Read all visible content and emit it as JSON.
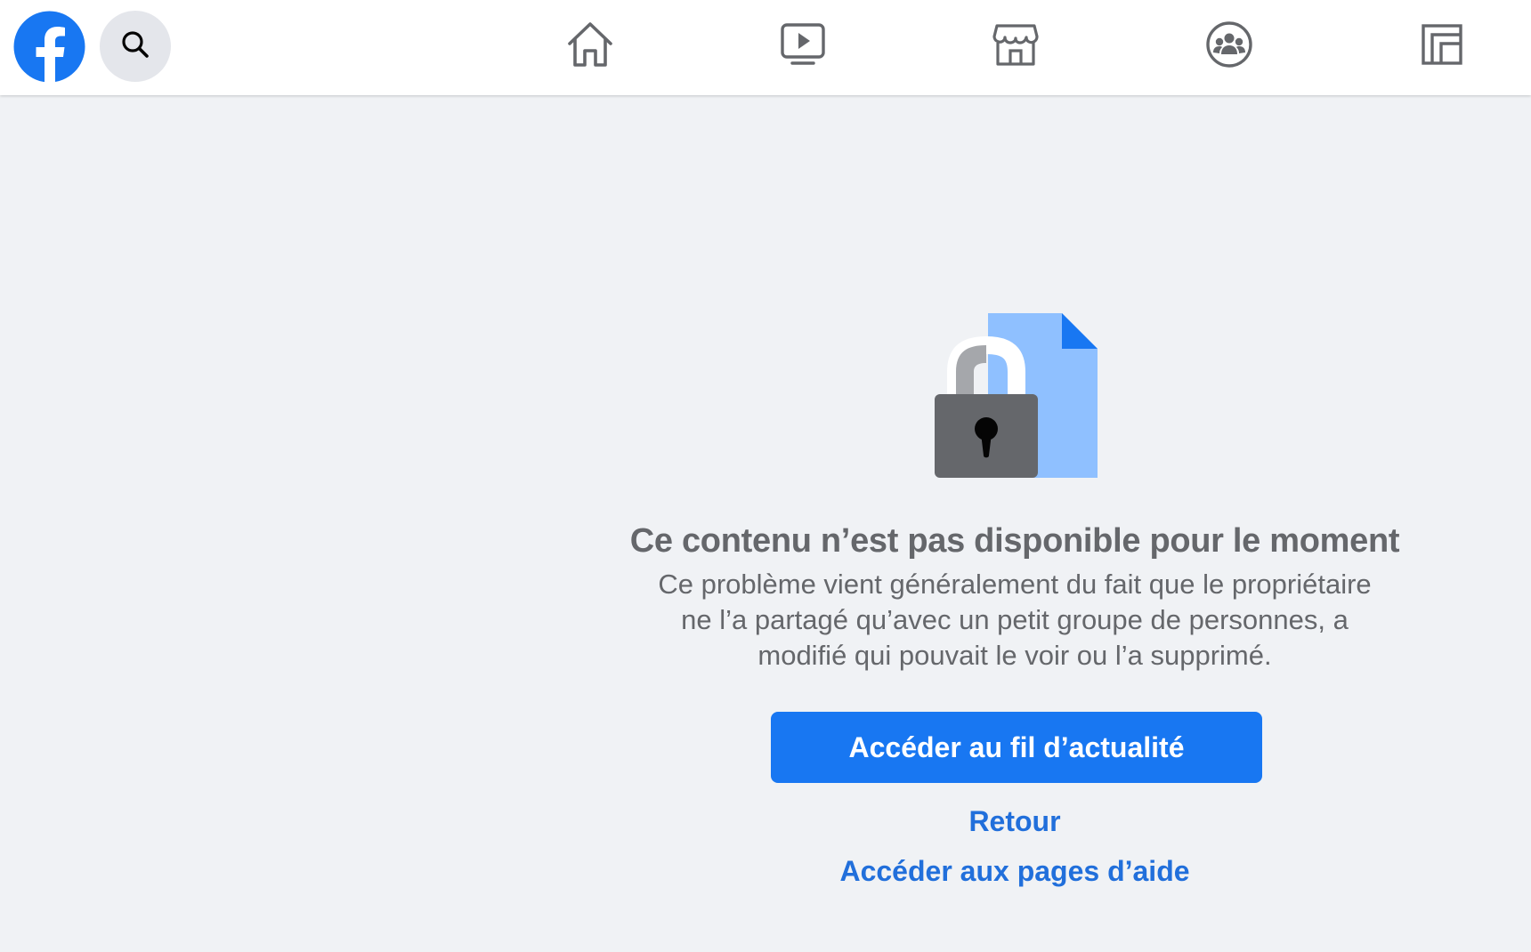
{
  "header": {
    "nav": [
      {
        "icon": "home-icon"
      },
      {
        "icon": "watch-icon"
      },
      {
        "icon": "marketplace-icon"
      },
      {
        "icon": "groups-icon"
      },
      {
        "icon": "gaming-icon"
      }
    ],
    "brand_color": "#1877f2"
  },
  "main": {
    "title": "Ce contenu n’est pas disponible pour le moment",
    "description": "Ce problème vient généralement du fait que le propriétaire\nne l’a partagé qu’avec un petit groupe de personnes, a\nmodifié qui pouvait le voir ou l’a supprimé.",
    "primary_button": "Accéder au fil d’actualité",
    "back_link": "Retour",
    "help_link": "Accéder aux pages d’aide"
  },
  "colors": {
    "background": "#f0f2f5",
    "primary": "#1877f2",
    "link": "#216fdb",
    "text_secondary": "#65676b"
  }
}
